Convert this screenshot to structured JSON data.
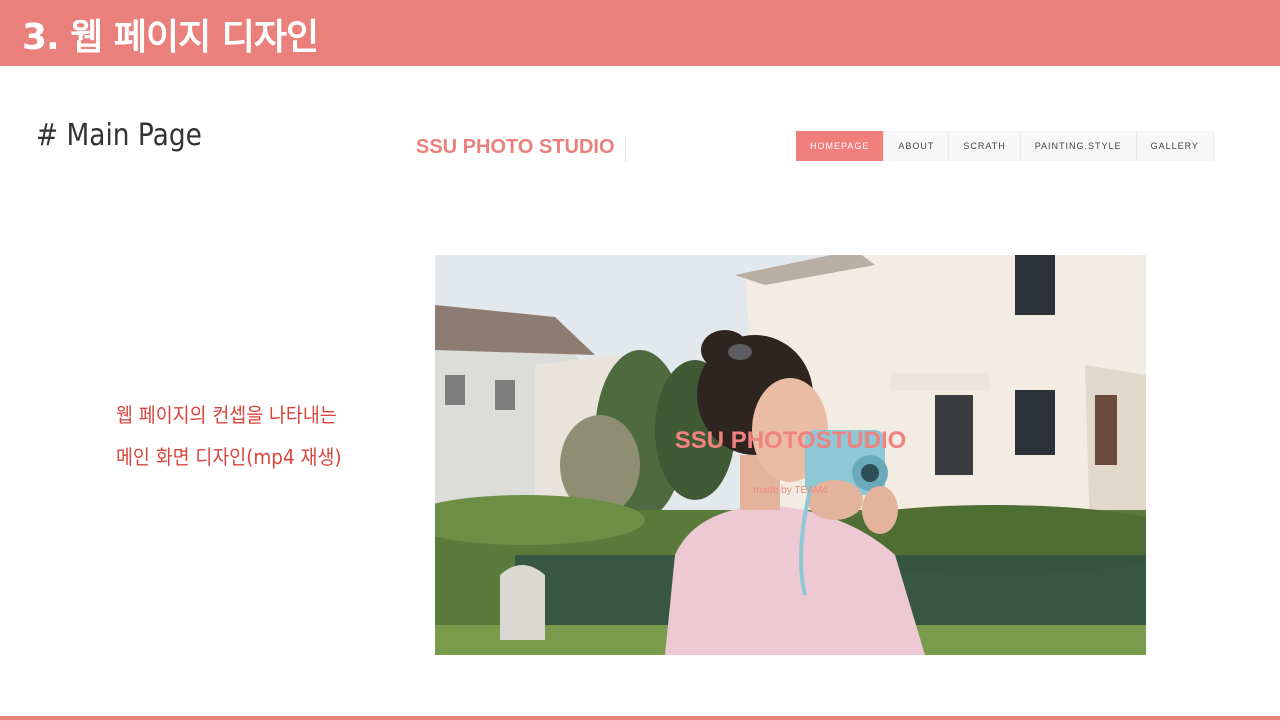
{
  "slide": {
    "title": "3. 웹 페이지 디자인",
    "section_heading": "# Main Page",
    "description_lines": [
      "웹 페이지의 컨셉을 나타내는",
      "메인 화면 디자인(mp4 재생)"
    ]
  },
  "site": {
    "logo": "SSU PHOTO STUDIO",
    "nav": [
      "HOMEPAGE",
      "ABOUT",
      "SCRATH",
      "PAINTING.STYLE",
      "GALLERY"
    ],
    "active_nav": "HOMEPAGE",
    "hero_title": "SSU PHOTOSTUDIO",
    "hero_subtitle": "made by TEAM4"
  },
  "colors": {
    "accent": "#e9807b",
    "description_text": "#d9453d"
  }
}
